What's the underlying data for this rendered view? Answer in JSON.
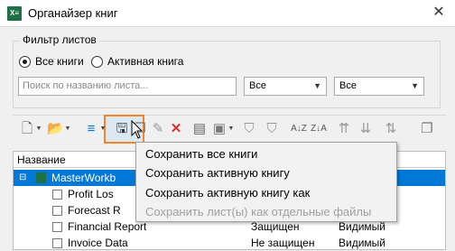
{
  "window": {
    "title": "Органайзер книг",
    "app_icon": "X≡",
    "close_icon": "✕"
  },
  "filter": {
    "group_label": "Фильтр листов",
    "radio_all": "Все книги",
    "radio_active": "Активная книга",
    "search_placeholder": "Поиск по названию листа...",
    "select1_value": "Все",
    "select2_value": "Все"
  },
  "tree": {
    "header_name": "Название",
    "workbook": "MasterWorkb",
    "rows": [
      {
        "name": "Profit Los",
        "status": "",
        "visibility": ""
      },
      {
        "name": "Forecast R",
        "status": "",
        "visibility": ""
      },
      {
        "name": "Financial Report",
        "status": "Защищен",
        "visibility": "Видимый"
      },
      {
        "name": "Invoice Data",
        "status": "Не защищен",
        "visibility": "Видимый"
      }
    ]
  },
  "menu": {
    "save_all": "Сохранить все книги",
    "save_active": "Сохранить активную книгу",
    "save_active_as": "Сохранить активную книгу как",
    "save_sheets": "Сохранить лист(ы) как отдельные файлы"
  },
  "colors": {
    "accent": "#0078d7",
    "highlight": "#f4842c",
    "excel": "#1e7145"
  }
}
